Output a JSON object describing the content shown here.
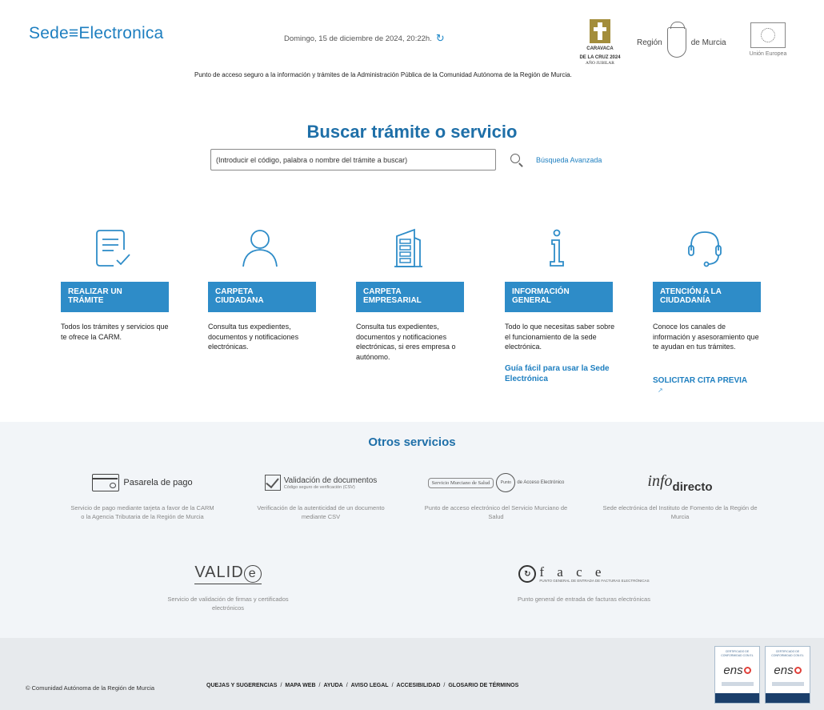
{
  "header": {
    "logo_text_a": "Sede",
    "logo_text_b": "Electronica",
    "datetime": "Domingo, 15 de diciembre de 2024, 20:22h.",
    "tagline": "Punto de acceso seguro a la información y trámites de la Administración Pública de la Comunidad Autónoma de la Región de Murcia.",
    "caravaca_line1": "CARAVACA",
    "caravaca_line2": "DE LA CRUZ 2024",
    "caravaca_line3": "AÑO JUBILAR",
    "region_left": "Región",
    "region_right": "de Murcia",
    "eu_label": "Unión Europea"
  },
  "search": {
    "title": "Buscar trámite o servicio",
    "placeholder": "(Introducir el código, palabra o nombre del trámite a buscar)",
    "advanced_label": "Búsqueda Avanzada"
  },
  "cards": [
    {
      "line1": "REALIZAR UN",
      "line2": "TRÁMITE",
      "desc": "Todos los trámites y servicios que te ofrece la CARM.",
      "link": ""
    },
    {
      "line1": "CARPETA",
      "line2": "CIUDADANA",
      "desc": "Consulta tus expedientes, documentos y notificaciones electrónicas.",
      "link": ""
    },
    {
      "line1": "CARPETA",
      "line2": "EMPRESARIAL",
      "desc": "Consulta tus expedientes, documentos y notificaciones electrónicas, si eres empresa o autónomo.",
      "link": ""
    },
    {
      "line1": "INFORMACIÓN",
      "line2": "GENERAL",
      "desc": "Todo lo que necesitas saber sobre el funcionamiento de la sede electrónica.",
      "link": "Guía fácil para usar la Sede Electrónica"
    },
    {
      "line1": "ATENCIÓN A LA",
      "line2": "CIUDADANÍA",
      "desc": "Conoce los canales de información y asesoramiento que te ayudan en tus trámites.",
      "link": "SOLICITAR CITA PREVIA"
    }
  ],
  "otros": {
    "title": "Otros servicios",
    "services": [
      {
        "logo": "Pasarela de pago",
        "desc": "Servicio de pago mediante tarjeta a favor de la CARM o la Agencia Tributaria de la Región de Murcia"
      },
      {
        "logo": "Validación de documentos",
        "logo_sub": "Código seguro de verificación (CSV)",
        "desc": "Verificación de la autenticidad de un documento mediante CSV"
      },
      {
        "logo": "de Acceso Electrónico",
        "logo_box": "Servicio Murciano de Salud",
        "logo_circ": "Punto",
        "desc": "Punto de acceso electrónico del Servicio Murciano de Salud"
      },
      {
        "logo_a": "info",
        "logo_b": "directo",
        "desc": "Sede electrónica del Instituto de Fomento de la Región de Murcia"
      },
      {
        "logo": "VALID",
        "logo_e": "e",
        "desc": "Servicio de validación de firmas y certificados electrónicos"
      },
      {
        "logo": "f a c e",
        "logo_sub": "PUNTO GENERAL DE ENTRADA DE FACTURAS ELECTRÓNICAS",
        "desc": "Punto general de entrada de facturas electrónicas"
      }
    ]
  },
  "footer": {
    "copyright": "© Comunidad Autónoma de la Región de Murcia",
    "links": [
      "QUEJAS Y SUGERENCIAS",
      "MAPA WEB",
      "AYUDA",
      "AVISO LEGAL",
      "ACCESIBILIDAD",
      "GLOSARIO DE TÉRMINOS"
    ],
    "ens_top": "CERTIFICADO DE CONFORMIDAD CON EL",
    "ens_logo": "ens"
  },
  "colors": {
    "primary": "#2e8cc8",
    "title": "#1e6fa8",
    "link": "#1e7fc0",
    "otros_bg": "#f2f5f8",
    "footer_bg": "#e7eaed"
  },
  "icons": [
    "refresh-icon",
    "search-icon",
    "document-check-icon",
    "user-icon",
    "building-icon",
    "info-icon",
    "headset-icon",
    "external-link-icon",
    "credit-card-icon",
    "checkbox-icon"
  ]
}
